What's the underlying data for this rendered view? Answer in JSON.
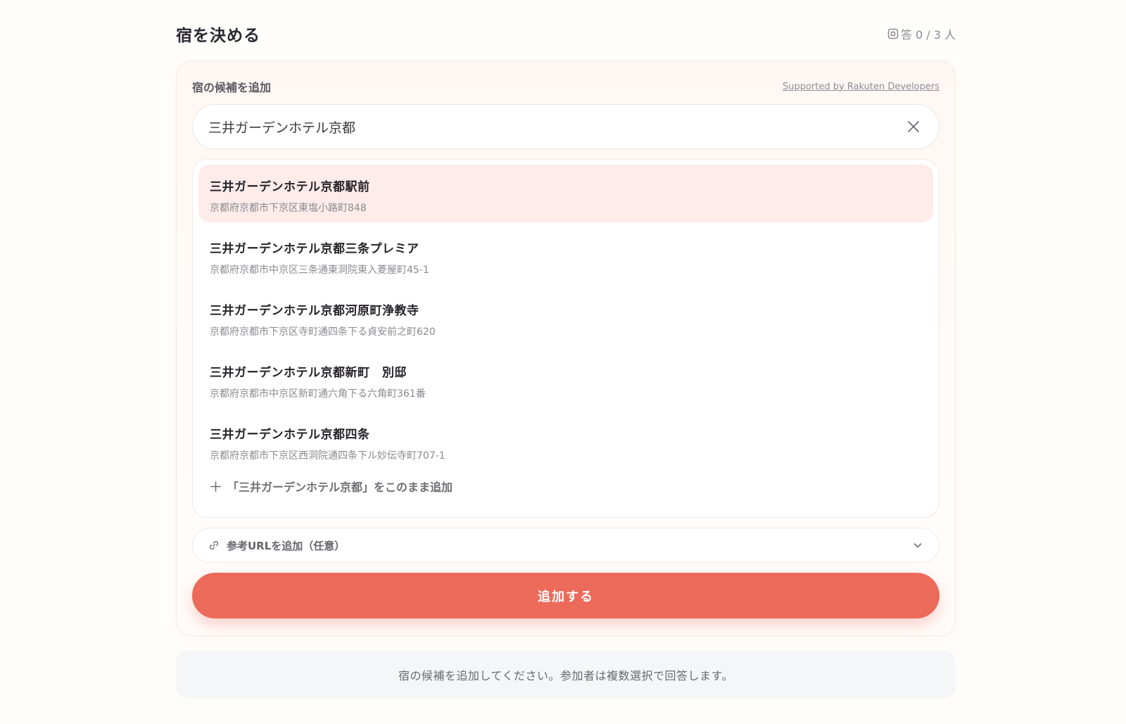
{
  "header": {
    "title": "宿を決める",
    "answer_count": "答 0 / 3 人"
  },
  "add_section": {
    "label": "宿の候補を追加",
    "supported_by": "Supported by Rakuten Developers",
    "search": {
      "value": "三井ガーデンホテル京都",
      "placeholder": ""
    },
    "suggestions": [
      {
        "name": "三井ガーデンホテル京都駅前",
        "address": "京都府京都市下京区東塩小路町848"
      },
      {
        "name": "三井ガーデンホテル京都三条プレミア",
        "address": "京都府京都市中京区三条通東洞院東入菱屋町45-1"
      },
      {
        "name": "三井ガーデンホテル京都河原町浄教寺",
        "address": "京都府京都市下京区寺町通四条下る貞安前之町620"
      },
      {
        "name": "三井ガーデンホテル京都新町　別邸",
        "address": "京都府京都市中京区新町通六角下る六角町361番"
      },
      {
        "name": "三井ガーデンホテル京都四条",
        "address": "京都府京都市下京区西洞院通四条下ル妙伝寺町707-1"
      }
    ],
    "add_as_is": "「三井ガーデンホテル京都」をこのまま追加",
    "url_toggle_label": "参考URLを追加（任意）",
    "submit_label": "追加する"
  },
  "info_text": "宿の候補を追加してください。参加者は複数選択で回答します。",
  "icons": {
    "answer": "answer-box-icon",
    "clear": "close-icon",
    "add": "plus-icon",
    "link": "link-icon",
    "expand": "chevron-down-icon"
  },
  "colors": {
    "accent": "#ec6a5a",
    "highlight": "#fdecea",
    "info_bg": "#f4f6f8"
  }
}
